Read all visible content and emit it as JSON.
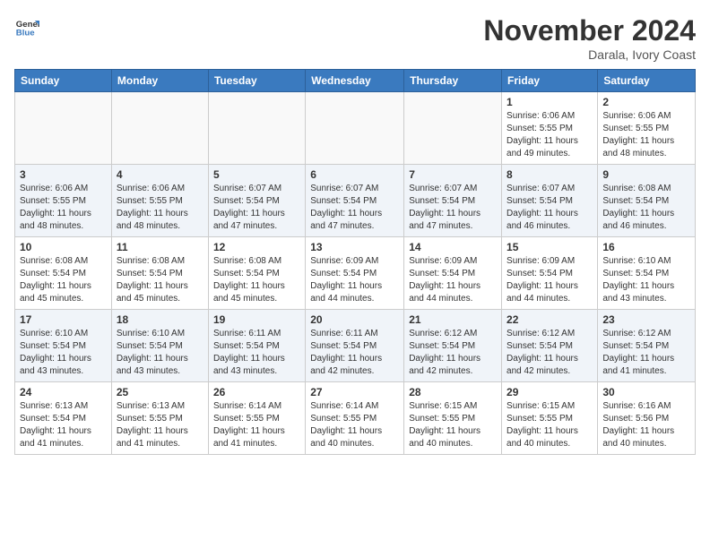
{
  "header": {
    "logo": {
      "general": "General",
      "blue": "Blue"
    },
    "month": "November 2024",
    "location": "Darala, Ivory Coast"
  },
  "weekdays": [
    "Sunday",
    "Monday",
    "Tuesday",
    "Wednesday",
    "Thursday",
    "Friday",
    "Saturday"
  ],
  "weeks": [
    [
      {
        "day": "",
        "info": ""
      },
      {
        "day": "",
        "info": ""
      },
      {
        "day": "",
        "info": ""
      },
      {
        "day": "",
        "info": ""
      },
      {
        "day": "",
        "info": ""
      },
      {
        "day": "1",
        "info": "Sunrise: 6:06 AM\nSunset: 5:55 PM\nDaylight: 11 hours and 49 minutes."
      },
      {
        "day": "2",
        "info": "Sunrise: 6:06 AM\nSunset: 5:55 PM\nDaylight: 11 hours and 48 minutes."
      }
    ],
    [
      {
        "day": "3",
        "info": "Sunrise: 6:06 AM\nSunset: 5:55 PM\nDaylight: 11 hours and 48 minutes."
      },
      {
        "day": "4",
        "info": "Sunrise: 6:06 AM\nSunset: 5:55 PM\nDaylight: 11 hours and 48 minutes."
      },
      {
        "day": "5",
        "info": "Sunrise: 6:07 AM\nSunset: 5:54 PM\nDaylight: 11 hours and 47 minutes."
      },
      {
        "day": "6",
        "info": "Sunrise: 6:07 AM\nSunset: 5:54 PM\nDaylight: 11 hours and 47 minutes."
      },
      {
        "day": "7",
        "info": "Sunrise: 6:07 AM\nSunset: 5:54 PM\nDaylight: 11 hours and 47 minutes."
      },
      {
        "day": "8",
        "info": "Sunrise: 6:07 AM\nSunset: 5:54 PM\nDaylight: 11 hours and 46 minutes."
      },
      {
        "day": "9",
        "info": "Sunrise: 6:08 AM\nSunset: 5:54 PM\nDaylight: 11 hours and 46 minutes."
      }
    ],
    [
      {
        "day": "10",
        "info": "Sunrise: 6:08 AM\nSunset: 5:54 PM\nDaylight: 11 hours and 45 minutes."
      },
      {
        "day": "11",
        "info": "Sunrise: 6:08 AM\nSunset: 5:54 PM\nDaylight: 11 hours and 45 minutes."
      },
      {
        "day": "12",
        "info": "Sunrise: 6:08 AM\nSunset: 5:54 PM\nDaylight: 11 hours and 45 minutes."
      },
      {
        "day": "13",
        "info": "Sunrise: 6:09 AM\nSunset: 5:54 PM\nDaylight: 11 hours and 44 minutes."
      },
      {
        "day": "14",
        "info": "Sunrise: 6:09 AM\nSunset: 5:54 PM\nDaylight: 11 hours and 44 minutes."
      },
      {
        "day": "15",
        "info": "Sunrise: 6:09 AM\nSunset: 5:54 PM\nDaylight: 11 hours and 44 minutes."
      },
      {
        "day": "16",
        "info": "Sunrise: 6:10 AM\nSunset: 5:54 PM\nDaylight: 11 hours and 43 minutes."
      }
    ],
    [
      {
        "day": "17",
        "info": "Sunrise: 6:10 AM\nSunset: 5:54 PM\nDaylight: 11 hours and 43 minutes."
      },
      {
        "day": "18",
        "info": "Sunrise: 6:10 AM\nSunset: 5:54 PM\nDaylight: 11 hours and 43 minutes."
      },
      {
        "day": "19",
        "info": "Sunrise: 6:11 AM\nSunset: 5:54 PM\nDaylight: 11 hours and 43 minutes."
      },
      {
        "day": "20",
        "info": "Sunrise: 6:11 AM\nSunset: 5:54 PM\nDaylight: 11 hours and 42 minutes."
      },
      {
        "day": "21",
        "info": "Sunrise: 6:12 AM\nSunset: 5:54 PM\nDaylight: 11 hours and 42 minutes."
      },
      {
        "day": "22",
        "info": "Sunrise: 6:12 AM\nSunset: 5:54 PM\nDaylight: 11 hours and 42 minutes."
      },
      {
        "day": "23",
        "info": "Sunrise: 6:12 AM\nSunset: 5:54 PM\nDaylight: 11 hours and 41 minutes."
      }
    ],
    [
      {
        "day": "24",
        "info": "Sunrise: 6:13 AM\nSunset: 5:54 PM\nDaylight: 11 hours and 41 minutes."
      },
      {
        "day": "25",
        "info": "Sunrise: 6:13 AM\nSunset: 5:55 PM\nDaylight: 11 hours and 41 minutes."
      },
      {
        "day": "26",
        "info": "Sunrise: 6:14 AM\nSunset: 5:55 PM\nDaylight: 11 hours and 41 minutes."
      },
      {
        "day": "27",
        "info": "Sunrise: 6:14 AM\nSunset: 5:55 PM\nDaylight: 11 hours and 40 minutes."
      },
      {
        "day": "28",
        "info": "Sunrise: 6:15 AM\nSunset: 5:55 PM\nDaylight: 11 hours and 40 minutes."
      },
      {
        "day": "29",
        "info": "Sunrise: 6:15 AM\nSunset: 5:55 PM\nDaylight: 11 hours and 40 minutes."
      },
      {
        "day": "30",
        "info": "Sunrise: 6:16 AM\nSunset: 5:56 PM\nDaylight: 11 hours and 40 minutes."
      }
    ]
  ]
}
